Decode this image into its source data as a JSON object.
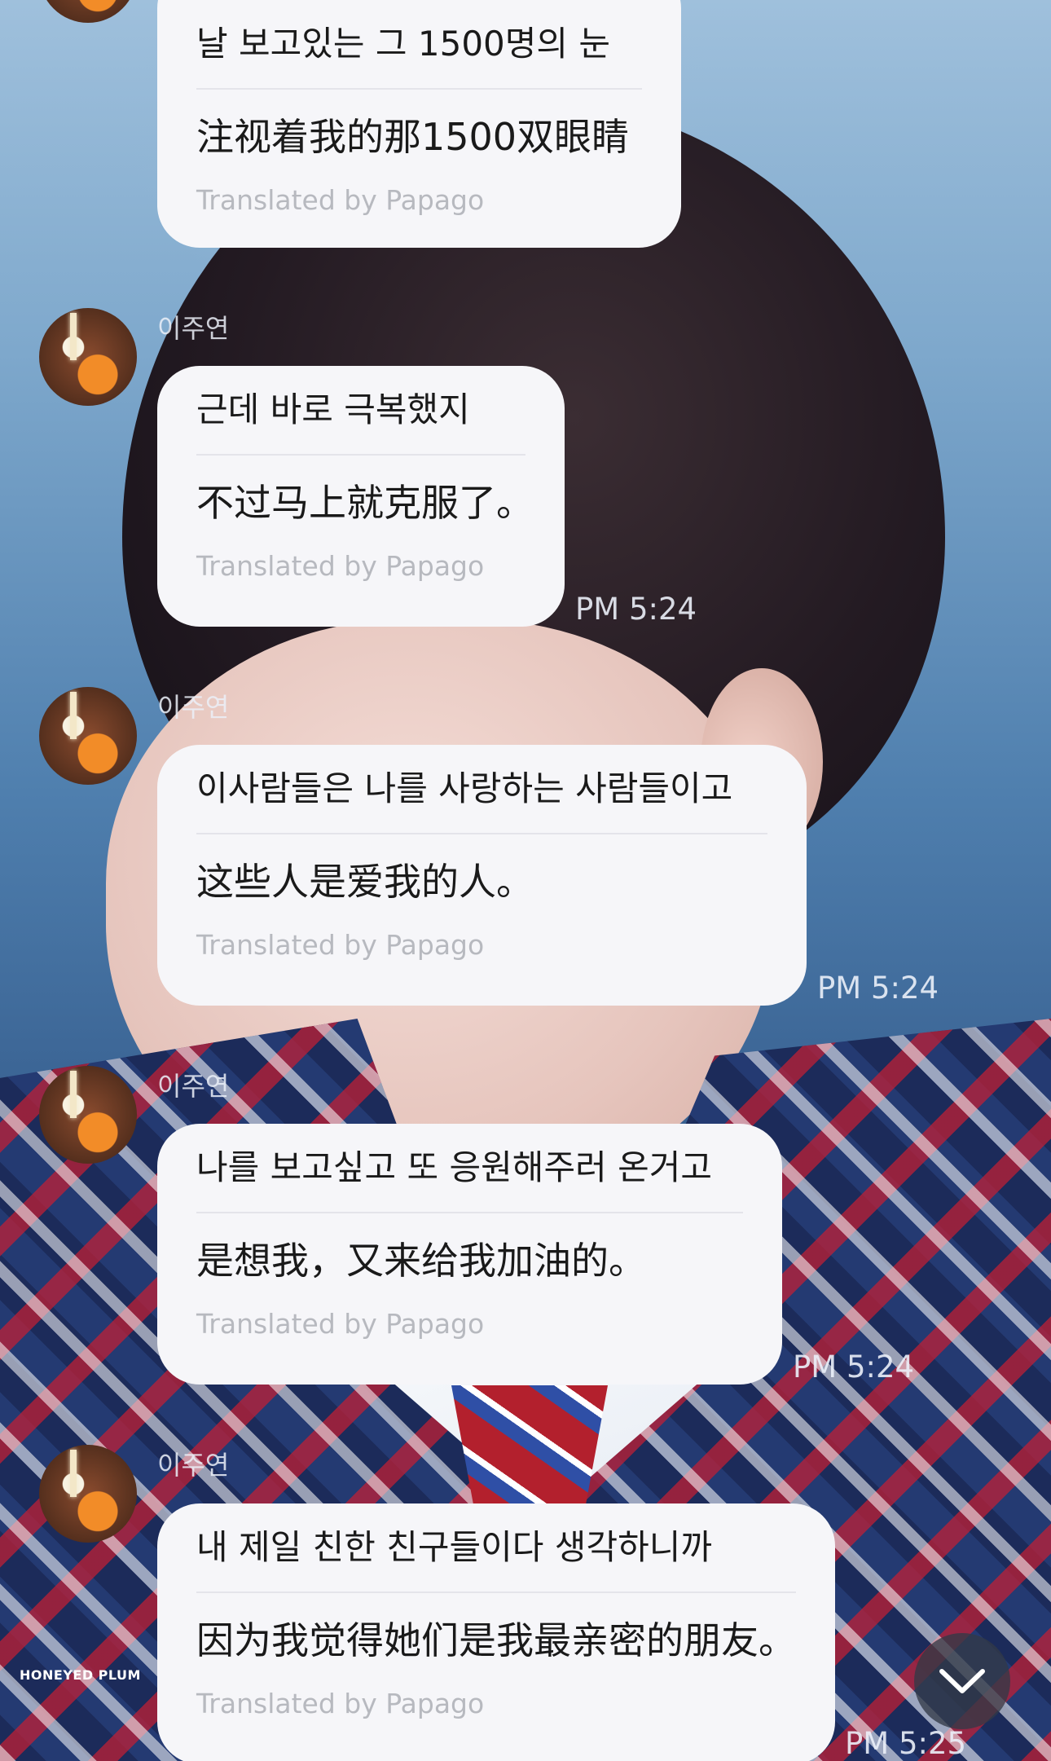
{
  "messages": [
    {
      "korean": "날 보고있는 그 1500명의 눈",
      "chinese": "注视着我的那1500双眼睛",
      "translated_by": "Translated by Papago"
    },
    {
      "sender": "이주연",
      "korean": "근데 바로 극복했지",
      "chinese": "不过马上就克服了。",
      "translated_by": "Translated by Papago",
      "time": "PM 5:24"
    },
    {
      "sender": "이주연",
      "korean": "이사람들은 나를 사랑하는 사람들이고",
      "chinese": "这些人是爱我的人。",
      "translated_by": "Translated by Papago",
      "time": "PM 5:24"
    },
    {
      "sender": "이주연",
      "korean": "나를 보고싶고 또 응원해주러 온거고",
      "chinese": "是想我，又来给我加油的。",
      "translated_by": "Translated by Papago",
      "time": "PM 5:24"
    },
    {
      "sender": "이주연",
      "korean": "내 제일 친한 친구들이다 생각하니까",
      "chinese": "因为我觉得她们是我最亲密的朋友。",
      "translated_by": "Translated by Papago",
      "time": "PM 5:25"
    }
  ],
  "watermark": "HONEYED PLUM",
  "icons": {
    "scroll_down": "chevron-down-icon",
    "avatar": "avatar"
  }
}
